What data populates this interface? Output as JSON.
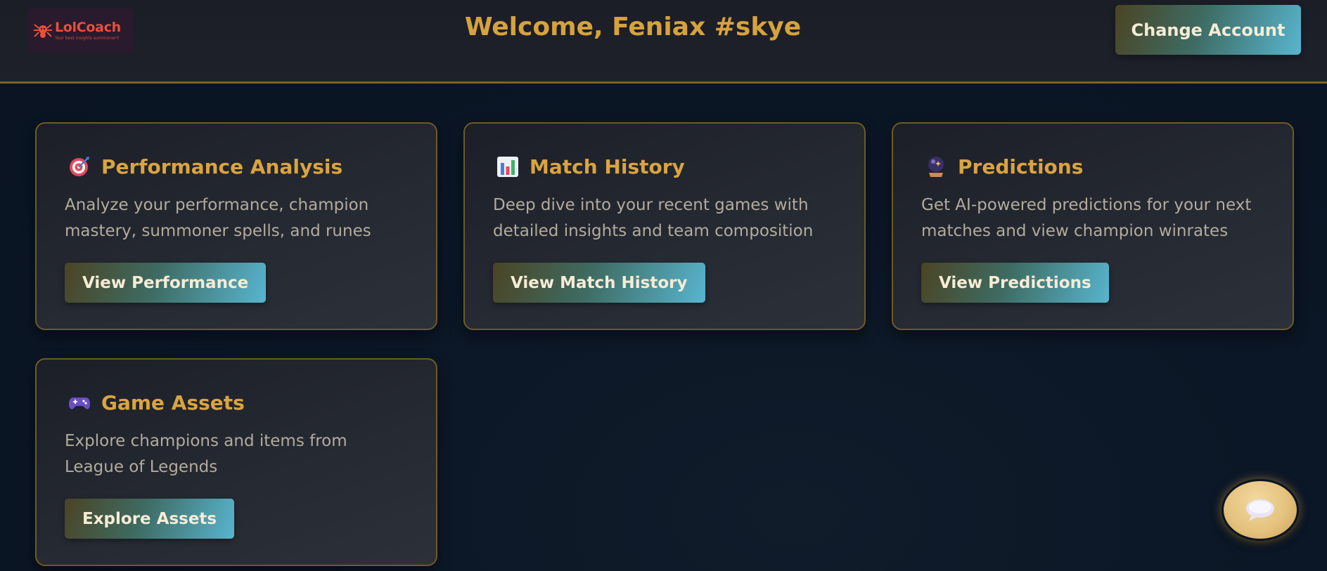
{
  "header": {
    "logo": {
      "name": "LolCoach",
      "tagline": "Your best insights summoner!!",
      "icon": "spider-logo-icon"
    },
    "welcome": "Welcome, Feniax #skye",
    "change_account_label": "Change Account"
  },
  "cards": [
    {
      "icon": "target-icon",
      "title": "Performance Analysis",
      "description": "Analyze your performance, champion mastery, summoner spells, and runes",
      "button_label": "View Performance"
    },
    {
      "icon": "bar-chart-icon",
      "title": "Match History",
      "description": "Deep dive into your recent games with detailed insights and team composition",
      "button_label": "View Match History"
    },
    {
      "icon": "crystal-ball-icon",
      "title": "Predictions",
      "description": "Get AI-powered predictions for your next matches and view champion winrates",
      "button_label": "View Predictions"
    },
    {
      "icon": "game-controller-icon",
      "title": "Game Assets",
      "description": "Explore champions and items from League of Legends",
      "button_label": "Explore Assets"
    }
  ],
  "chat": {
    "icon": "speech-bubble-icon"
  },
  "colors": {
    "accent_gold": "#d7a23d",
    "card_border": "#6e5a25",
    "button_gradient_start": "#4b4424",
    "button_gradient_end": "#58b5cf",
    "background": "#0b1626"
  }
}
